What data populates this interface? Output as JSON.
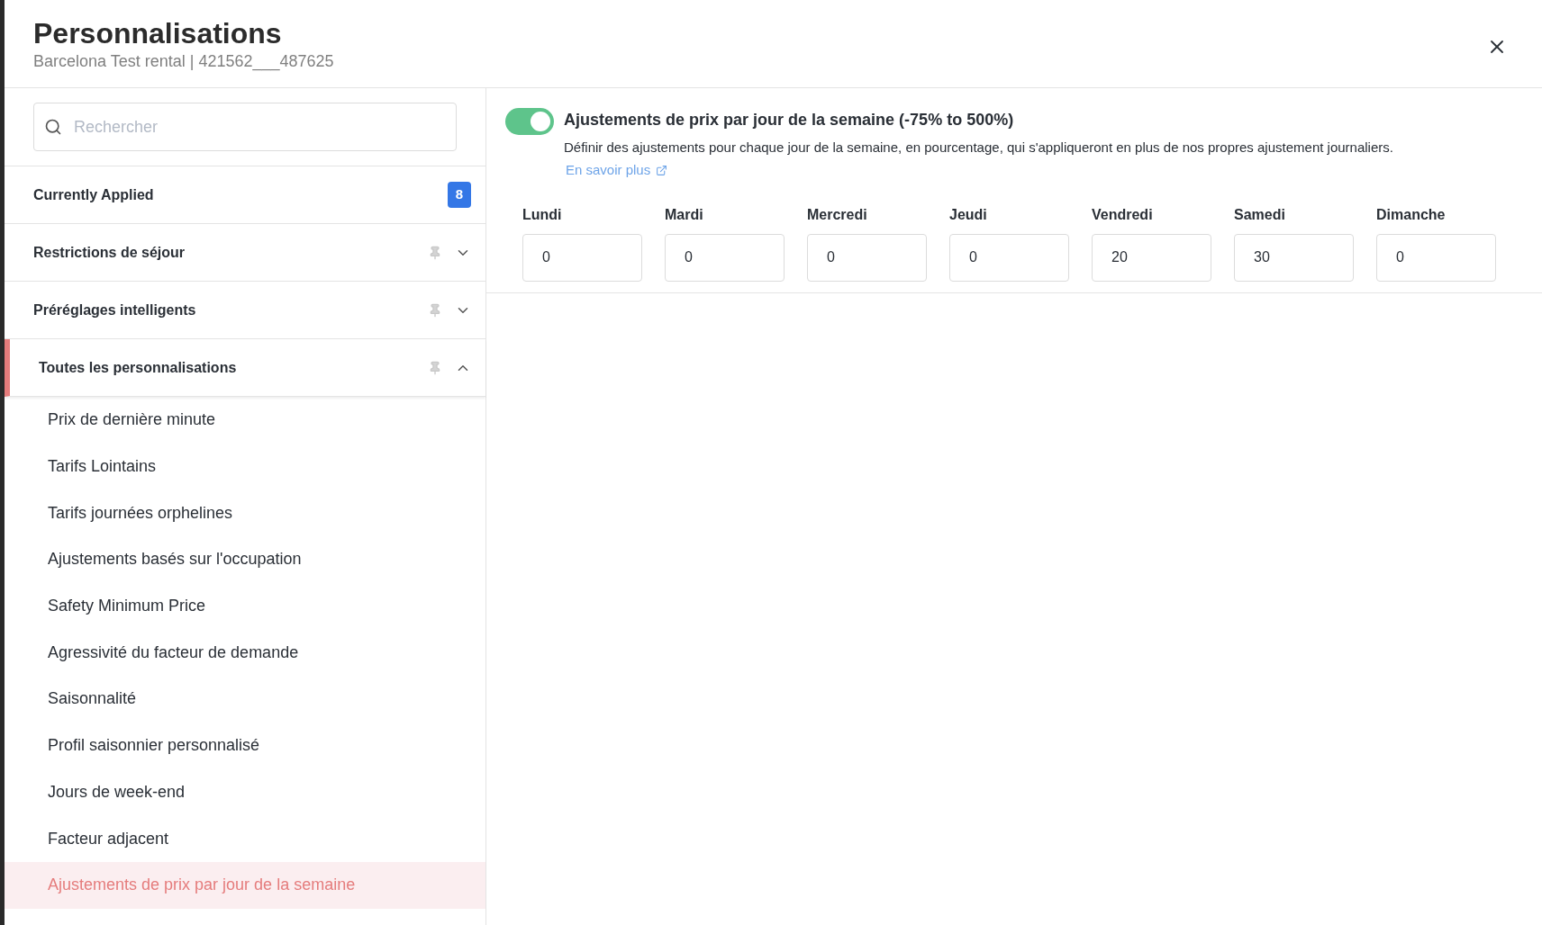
{
  "header": {
    "title": "Personnalisations",
    "subtitle": "Barcelona Test rental | 421562___487625"
  },
  "search": {
    "placeholder": "Rechercher"
  },
  "sections": [
    {
      "kind": "count",
      "label": "Currently Applied",
      "badge": "8",
      "selected": false
    },
    {
      "kind": "group",
      "label": "Restrictions de séjour",
      "expanded": false,
      "selected": false
    },
    {
      "kind": "group",
      "label": "Préréglages intelligents",
      "expanded": false,
      "selected": false
    },
    {
      "kind": "group",
      "label": "Toutes les personnalisations",
      "expanded": true,
      "selected": true,
      "items": [
        {
          "label": "Prix de dernière minute",
          "selected": false
        },
        {
          "label": "Tarifs Lointains",
          "selected": false
        },
        {
          "label": "Tarifs journées orphelines",
          "selected": false
        },
        {
          "label": "Ajustements basés sur l'occupation",
          "selected": false
        },
        {
          "label": "Safety Minimum Price",
          "selected": false
        },
        {
          "label": "Agressivité du facteur de demande",
          "selected": false
        },
        {
          "label": "Saisonnalité",
          "selected": false
        },
        {
          "label": "Profil saisonnier personnalisé",
          "selected": false
        },
        {
          "label": "Jours de week-end",
          "selected": false
        },
        {
          "label": "Facteur adjacent",
          "selected": false
        },
        {
          "label": "Ajustements de prix par jour de la semaine",
          "selected": true
        }
      ]
    }
  ],
  "setting": {
    "on": true,
    "title": "Ajustements de prix par jour de la semaine (-75% to 500%)",
    "description": "Définir des ajustements pour chaque jour de la semaine, en pourcentage, qui s'appliqueront en plus de nos propres ajustement journaliers.",
    "link": "En savoir plus",
    "days": [
      {
        "label": "Lundi",
        "value": "0"
      },
      {
        "label": "Mardi",
        "value": "0"
      },
      {
        "label": "Mercredi",
        "value": "0"
      },
      {
        "label": "Jeudi",
        "value": "0"
      },
      {
        "label": "Vendredi",
        "value": "20"
      },
      {
        "label": "Samedi",
        "value": "30"
      },
      {
        "label": "Dimanche",
        "value": "0"
      }
    ]
  }
}
